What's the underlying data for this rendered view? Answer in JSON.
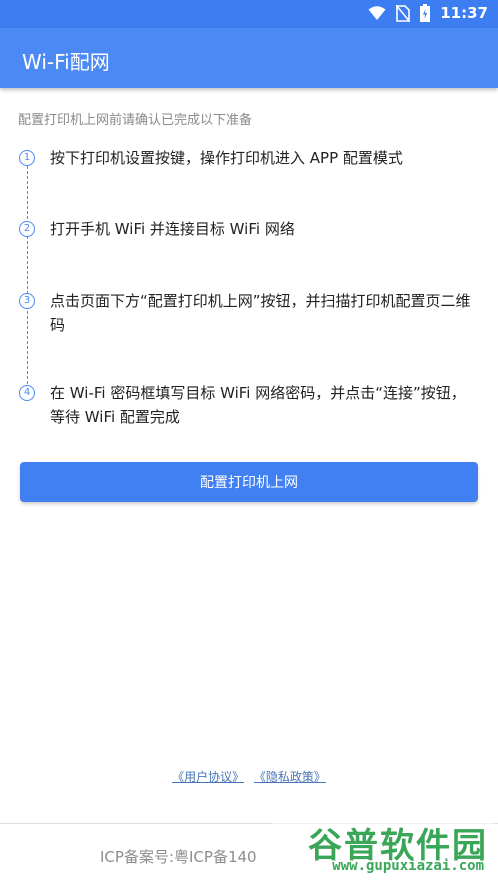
{
  "status_bar": {
    "time": "11:37",
    "icons": [
      "wifi-icon",
      "no-sim-icon",
      "battery-icon"
    ]
  },
  "app_bar": {
    "title": "Wi-Fi配网"
  },
  "intro": "配置打印机上网前请确认已完成以下准备",
  "steps": [
    {
      "num": "1",
      "text": "按下打印机设置按键，操作打印机进入 APP 配置模式"
    },
    {
      "num": "2",
      "text": "打开手机 WiFi 并连接目标 WiFi 网络"
    },
    {
      "num": "3",
      "text": "点击页面下方“配置打印机上网”按钮，并扫描打印机配置页二维码"
    },
    {
      "num": "4",
      "text": "在 Wi-Fi 密码框填写目标 WiFi 网络密码，并点击“连接”按钮，等待 WiFi 配置完成"
    }
  ],
  "primary_button": {
    "label": "配置打印机上网"
  },
  "links": {
    "user_agreement": "《用户协议》",
    "privacy_policy": "《隐私政策》"
  },
  "footer": {
    "icp": "ICP备案号:粤ICP备140"
  },
  "watermark": {
    "cn": "谷普软件园",
    "url": "www.gupuxiazai.com"
  },
  "colors": {
    "primary": "#4b89f5",
    "status_bar": "#3c7df2",
    "link": "#4a74b8",
    "watermark": "#3aa657"
  }
}
